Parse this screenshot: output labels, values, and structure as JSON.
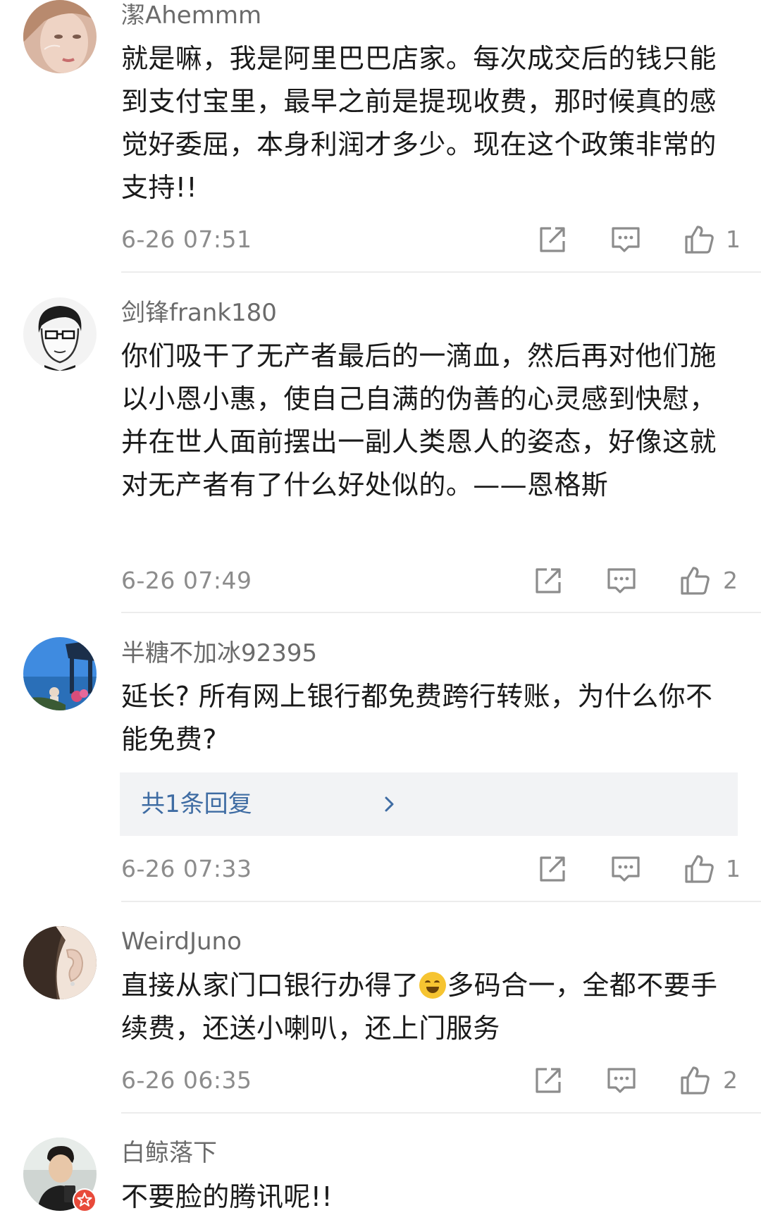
{
  "comments": [
    {
      "username": "潔Ahemmm",
      "text": "就是嘛，我是阿里巴巴店家。每次成交后的钱只能到支付宝里，最早之前是提现收费，那时候真的感觉好委屈，本身利润才多少。现在这个政策非常的支持!!",
      "timestamp": "6-26 07:51",
      "likes": "1",
      "avatar_icon": "portrait-woman-icon"
    },
    {
      "username": "剑锋frank180",
      "text": "你们吸干了无产者最后的一滴血，然后再对他们施以小恩小惠，使自己自满的伪善的心灵感到快慰，并在世人面前摆出一副人类恩人的姿态，好像这就对无产者有了什么好处似的。——恩格斯",
      "timestamp": "6-26 07:49",
      "likes": "2",
      "avatar_icon": "sketch-man-glasses-icon"
    },
    {
      "username": "半糖不加冰92395",
      "text": "延长? 所有网上银行都免费跨行转账，为什么你不能免费?",
      "timestamp": "6-26 07:33",
      "likes": "1",
      "replies_label": "共1条回复",
      "avatar_icon": "seaside-scene-icon"
    },
    {
      "username": "WeirdJuno",
      "text_before_emoji": "直接从家门口银行办得了",
      "emoji": "laughing-tears-emoji",
      "text_after_emoji": "多码合一，全都不要手续费，还送小喇叭，还上门服务",
      "timestamp": "6-26 06:35",
      "likes": "2",
      "avatar_icon": "ear-closeup-icon"
    },
    {
      "username": "白鲸落下",
      "text": "不要脸的腾讯呢!!",
      "avatar_icon": "selfie-man-icon",
      "badge_icon": "verified-star-badge-icon"
    }
  ],
  "colors": {
    "username": "#6b6b6b",
    "text": "#1a1a1a",
    "meta": "#8c8c8c",
    "replies_bg": "#f2f3f5",
    "replies_link": "#3f6ca3",
    "badge": "#e84a3a"
  }
}
